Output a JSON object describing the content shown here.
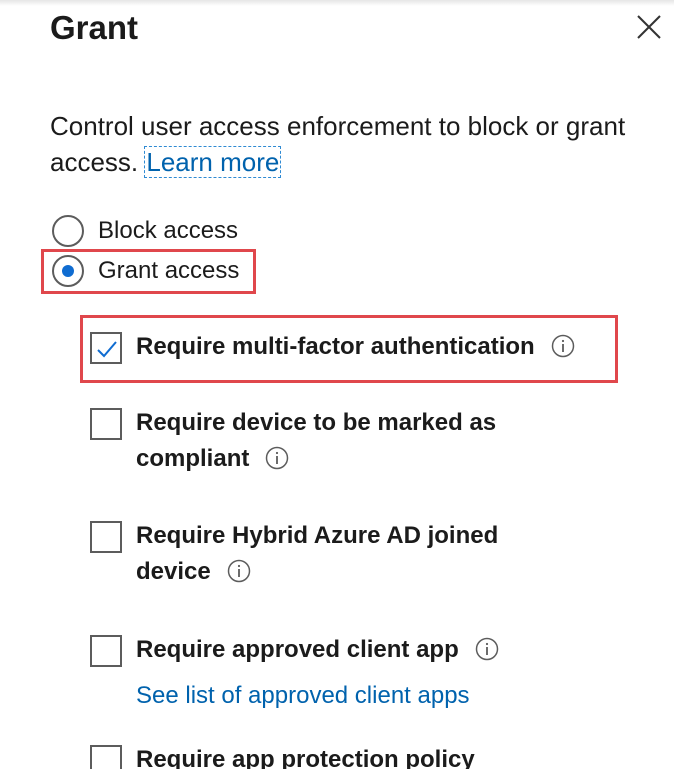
{
  "panel": {
    "title": "Grant",
    "close_label": "Close"
  },
  "intro": {
    "text": "Control user access enforcement to block or grant access.",
    "learn_more": "Learn more"
  },
  "access_options": [
    {
      "label": "Block access",
      "selected": false
    },
    {
      "label": "Grant access",
      "selected": true
    }
  ],
  "controls": [
    {
      "line1": "Require multi-factor authentication",
      "line2": "",
      "checked": true,
      "info": true
    },
    {
      "line1": "Require device to be marked as",
      "line2": "compliant",
      "checked": false,
      "info": true
    },
    {
      "line1": "Require Hybrid Azure AD joined",
      "line2": "device",
      "checked": false,
      "info": true
    },
    {
      "line1": "Require approved client app",
      "line2": "",
      "checked": false,
      "info": true,
      "link": "See list of approved client apps"
    },
    {
      "line1": "Require app protection policy",
      "line2": "",
      "checked": false,
      "info": false
    }
  ],
  "colors": {
    "accent": "#0f6cd1",
    "link": "#0062ad",
    "highlight": "#e0474c"
  }
}
